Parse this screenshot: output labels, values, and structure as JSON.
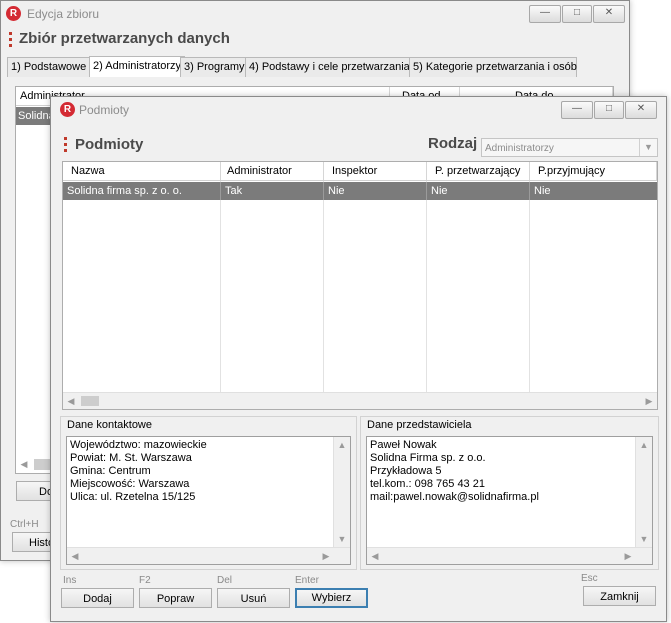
{
  "back_window": {
    "title": "Edycja zbioru",
    "heading": "Zbiór przetwarzanych danych",
    "tabs": [
      {
        "label": "1) Podstawowe"
      },
      {
        "label": "2) Administratorzy"
      },
      {
        "label": "3) Programy"
      },
      {
        "label": "4) Podstawy i cele przetwarzania"
      },
      {
        "label": "5) Kategorie przetwarzania i osób"
      }
    ],
    "columns": [
      "Administrator",
      "Data od",
      "Data do"
    ],
    "selected_row_text": "Solidna",
    "button_partial": "Do",
    "shortcut_partial": "Ctrl+H",
    "history_button_partial": "Histo"
  },
  "dialog": {
    "title": "Podmioty",
    "heading": "Podmioty",
    "rodzaj_label": "Rodzaj",
    "rodzaj_value": "Administratorzy",
    "columns": [
      "Nazwa",
      "Administrator",
      "Inspektor",
      "P. przetwarzający",
      "P.przyjmujący"
    ],
    "rows": [
      [
        "Solidna firma sp. z o. o.",
        "Tak",
        "Nie",
        "Nie",
        "Nie"
      ]
    ],
    "contact": {
      "title": "Dane kontaktowe",
      "lines": [
        "Województwo: mazowieckie",
        "Powiat: M. St. Warszawa",
        "Gmina: Centrum",
        "Miejscowość: Warszawa",
        "Ulica: ul. Rzetelna 15/125"
      ]
    },
    "representative": {
      "title": "Dane przedstawiciela",
      "lines": [
        "Paweł Nowak",
        "Solidna Firma sp. z o.o.",
        "Przykładowa 5",
        "tel.kom.: 098 765 43 21",
        "mail:pawel.nowak@solidnafirma.pl"
      ]
    },
    "buttons": {
      "dodaj": {
        "label": "Dodaj",
        "shortcut": "Ins"
      },
      "popraw": {
        "label": "Popraw",
        "shortcut": "F2"
      },
      "usun": {
        "label": "Usuń",
        "shortcut": "Del"
      },
      "wybierz": {
        "label": "Wybierz",
        "shortcut": "Enter"
      },
      "zamknij": {
        "label": "Zamknij",
        "shortcut": "Esc"
      }
    }
  },
  "colors": {
    "accent": "#d42a33",
    "selection": "#7b7b7b",
    "default_button_border": "#3c7fb1"
  }
}
